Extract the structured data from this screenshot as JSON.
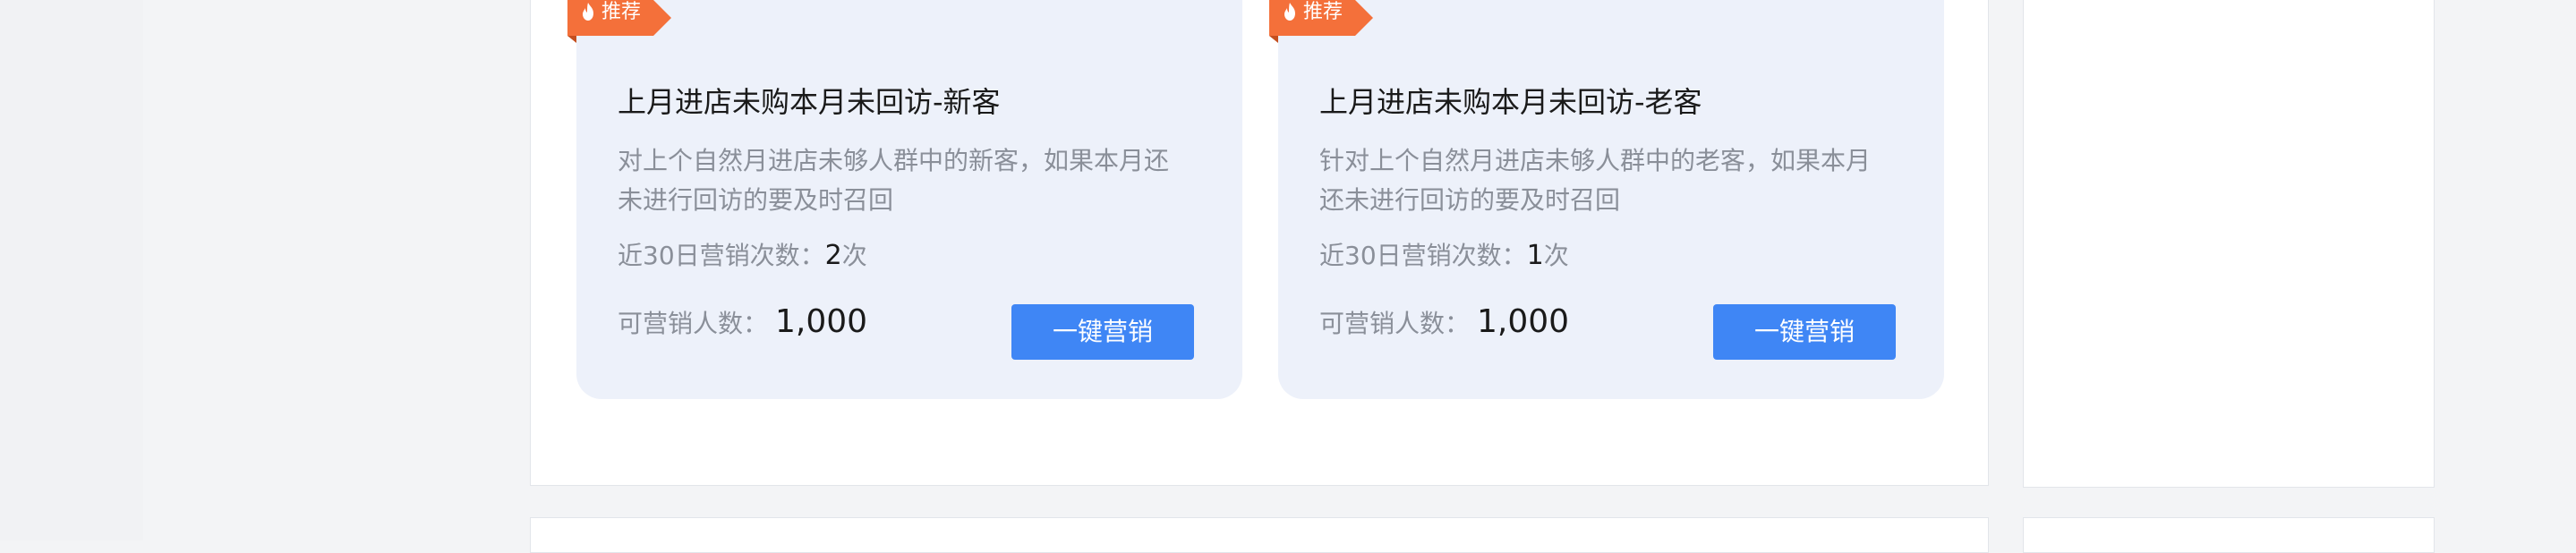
{
  "colors": {
    "page_bg": "#f3f4f6",
    "card_bg": "#edf1fa",
    "tag_bg": "#f4703a",
    "button_bg": "#3f86f5",
    "title_text": "#1a1a1a",
    "muted_text": "#8a8f99"
  },
  "cards": [
    {
      "tag_label": "推荐",
      "tag_icon": "flame-icon",
      "title": "上月进店未购本月未回访-新客",
      "description": "对上个自然月进店未够人群中的新客，如果本月还未进行回访的要及时召回",
      "count_label": "近30日营销次数：",
      "count_value": "2",
      "count_unit": "次",
      "reach_label": "可营销人数：",
      "reach_value": "1,000",
      "button_label": "一键营销"
    },
    {
      "tag_label": "推荐",
      "tag_icon": "flame-icon",
      "title": "上月进店未购本月未回访-老客",
      "description": "针对上个自然月进店未够人群中的老客，如果本月还未进行回访的要及时召回",
      "count_label": "近30日营销次数：",
      "count_value": "1",
      "count_unit": "次",
      "reach_label": "可营销人数：",
      "reach_value": "1,000",
      "button_label": "一键营销"
    }
  ]
}
